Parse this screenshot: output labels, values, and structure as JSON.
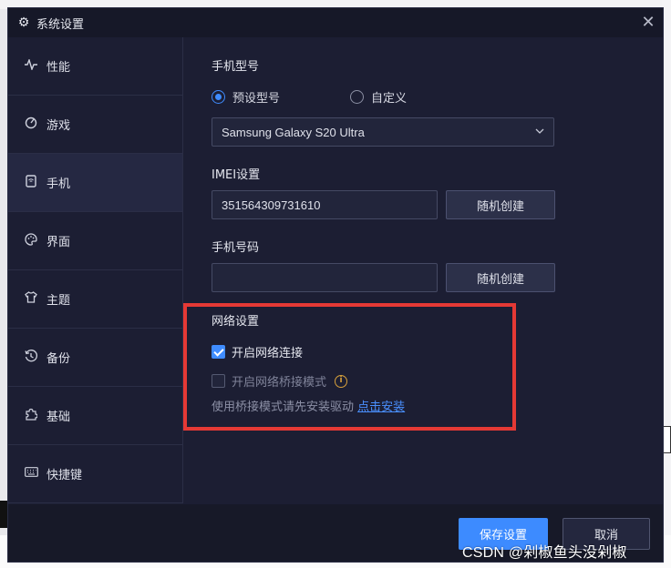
{
  "window": {
    "title": "系统设置",
    "close_glyph": "✕"
  },
  "sidebar": {
    "items": [
      {
        "label": "性能",
        "icon": "pulse-icon"
      },
      {
        "label": "游戏",
        "icon": "gamepad-icon"
      },
      {
        "label": "手机",
        "icon": "phone-icon"
      },
      {
        "label": "界面",
        "icon": "palette-icon"
      },
      {
        "label": "主题",
        "icon": "shirt-icon"
      },
      {
        "label": "备份",
        "icon": "history-icon"
      },
      {
        "label": "基础",
        "icon": "puzzle-icon"
      },
      {
        "label": "快捷键",
        "icon": "keyboard-icon"
      }
    ],
    "active_index": 2
  },
  "phone": {
    "model_label": "手机型号",
    "radio_preset": "预设型号",
    "radio_custom": "自定义",
    "selected_model": "Samsung Galaxy S20 Ultra",
    "imei_label": "IMEI设置",
    "imei_value": "351564309731610",
    "random_create_1": "随机创建",
    "phone_number_label": "手机号码",
    "phone_number_value": "",
    "random_create_2": "随机创建"
  },
  "network": {
    "section_label": "网络设置",
    "enable_network": "开启网络连接",
    "enable_network_checked": true,
    "bridge_mode": "开启网络桥接模式",
    "bridge_mode_checked": false,
    "hint_text": "使用桥接模式请先安装驱动",
    "hint_link": "点击安装"
  },
  "footer": {
    "save": "保存设置",
    "cancel": "取消"
  },
  "watermark": "CSDN @剁椒鱼头没剁椒",
  "colors": {
    "accent": "#3d8bff",
    "background": "#1c1e33",
    "highlight": "#e53935",
    "info": "#d8a13c"
  }
}
